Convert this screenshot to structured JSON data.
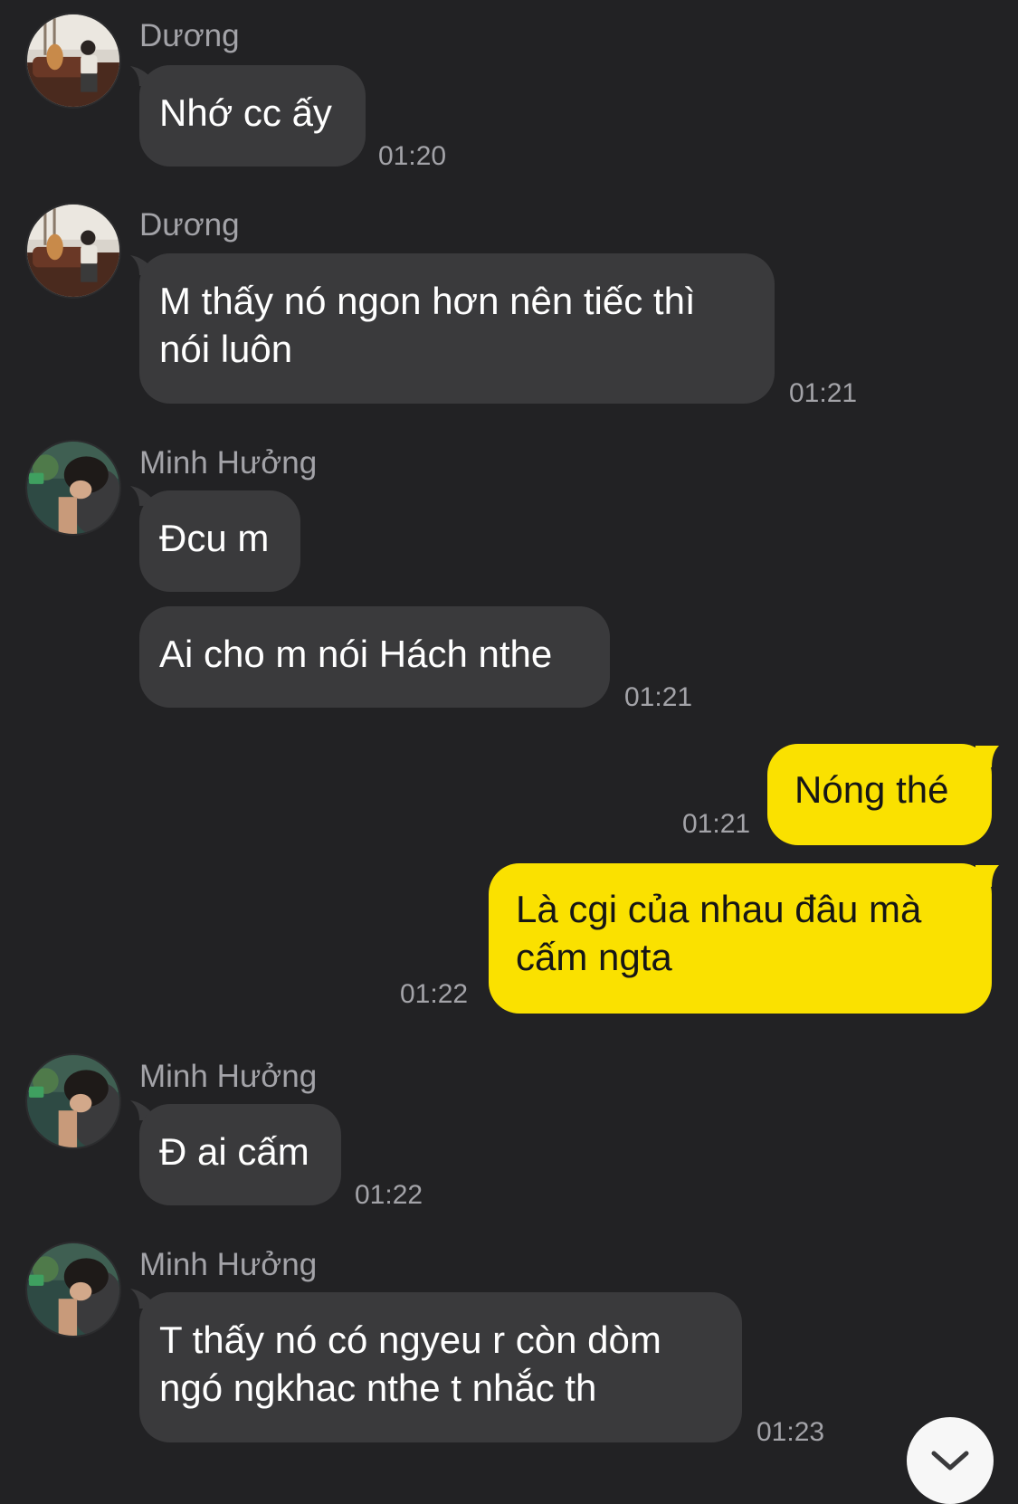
{
  "colors": {
    "background": "#222224",
    "incoming_bubble": "#3a3a3c",
    "outgoing_bubble": "#fae100",
    "meta_text": "#a3a3a8"
  },
  "icons": {
    "avatar_duong": "avatar-photo-icon",
    "avatar_minh_huong": "avatar-photo-icon",
    "scroll_down": "chevron-down-icon"
  },
  "messages": [
    {
      "from": "in",
      "sender": "Dương",
      "text": "Nhớ cc ấy",
      "time": "01:20"
    },
    {
      "from": "in",
      "sender": "Dương",
      "lines": [
        "M thấy nó ngon hơn nên tiếc thì",
        "nói luôn"
      ],
      "time": "01:21"
    },
    {
      "from": "in",
      "sender": "Minh Hưởng",
      "text": "Đcu m"
    },
    {
      "from": "in",
      "text": "Ai cho m nói Hách nthe",
      "time": "01:21"
    },
    {
      "from": "out",
      "text": "Nóng thé",
      "time": "01:21"
    },
    {
      "from": "out",
      "lines": [
        "Là cgi của nhau đâu mà",
        "cấm ngta"
      ],
      "time": "01:22"
    },
    {
      "from": "in",
      "sender": "Minh Hưởng",
      "text": "Đ ai cấm",
      "time": "01:22"
    },
    {
      "from": "in",
      "sender": "Minh Hưởng",
      "lines": [
        "T thấy nó có ngyeu r còn dòm",
        "ngó ngkhac nthe t nhắc th"
      ],
      "time": "01:23"
    }
  ]
}
